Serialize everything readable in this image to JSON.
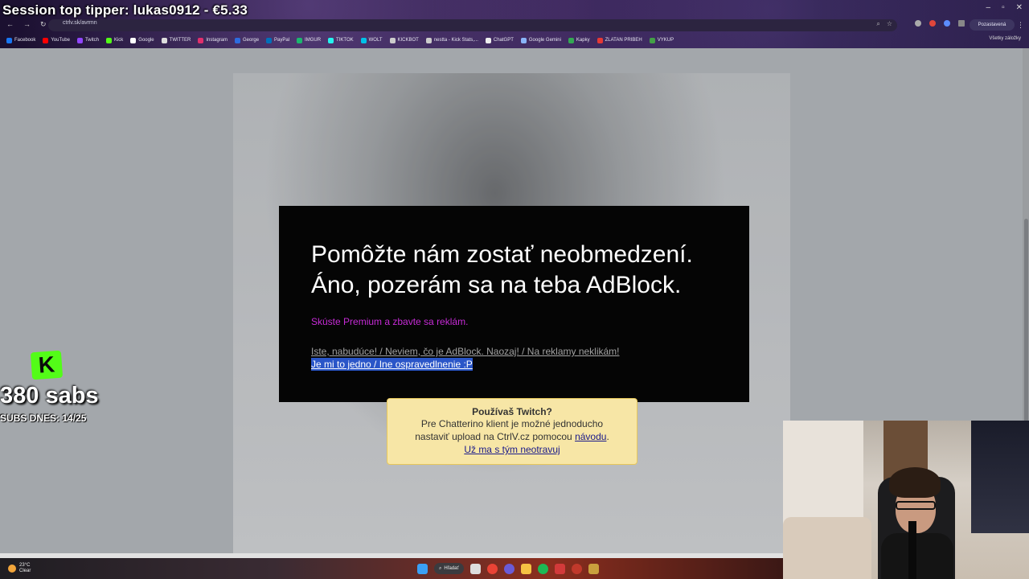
{
  "overlay": {
    "title": "Session top tipper: lukas0912 - €5.33",
    "kick_logo": "K",
    "subs_count": "380 sabs",
    "subs_today": "SUBS DNES: 14/25"
  },
  "browser": {
    "url": "ctrlv.sk/avrmn",
    "profile_label": "Pozastavená",
    "all_bookmarks": "Všetky záložky",
    "bookmarks": [
      {
        "label": "Facebook",
        "color": "#1877f2"
      },
      {
        "label": "YouTube",
        "color": "#ff0000"
      },
      {
        "label": "Twitch",
        "color": "#9146ff"
      },
      {
        "label": "Kick",
        "color": "#53fc18"
      },
      {
        "label": "Google",
        "color": "#ffffff"
      },
      {
        "label": "TWITTER",
        "color": "#dddddd"
      },
      {
        "label": "Instagram",
        "color": "#e1306c"
      },
      {
        "label": "George",
        "color": "#2d6cdf"
      },
      {
        "label": "PayPal",
        "color": "#0070ba"
      },
      {
        "label": "IMGUR",
        "color": "#1bb76e"
      },
      {
        "label": "TIKTOK",
        "color": "#25f4ee"
      },
      {
        "label": "WOLT",
        "color": "#00c2e8"
      },
      {
        "label": "KICKBOT",
        "color": "#cccccc"
      },
      {
        "label": "nestta - Kick Stats,...",
        "color": "#cccccc"
      },
      {
        "label": "ChatGPT",
        "color": "#eeeeee"
      },
      {
        "label": "Google Gemini",
        "color": "#8ab4f8"
      },
      {
        "label": "Kapky",
        "color": "#34a853"
      },
      {
        "label": "ZLATAN PRIBEH",
        "color": "#e53935"
      },
      {
        "label": "VYKUP",
        "color": "#43a047"
      }
    ]
  },
  "modal": {
    "heading_line1": "Pomôžte nám zostať neobmedzení.",
    "heading_line2": "Áno, pozerám sa na teba AdBlock.",
    "premium_link": "Skúste Premium a zbavte sa reklám.",
    "options_link": "Iste, nabudúce! / Neviem, čo je AdBlock. Naozaj! / Na reklamy neklikám!",
    "dismiss_link": "Je mi to jedno / Ine ospravedlnenie :P"
  },
  "notice": {
    "title": "Používaš Twitch?",
    "line1": "Pre Chatterino klient je možné jednoducho",
    "line2_prefix": "nastaviť upload na CtrlV.cz pomocou ",
    "line2_link": "návodu",
    "line2_suffix": ".",
    "dismiss": "Už ma s tým neotravuj"
  },
  "taskbar": {
    "temperature": "23°C",
    "weather": "Clear",
    "search_label": "Hľadať"
  },
  "colors": {
    "premium_link": "#c62bd6",
    "dismiss_highlight": "#2a56c8",
    "notice_bg": "#f7e6a6",
    "kick_green": "#53fc18"
  }
}
